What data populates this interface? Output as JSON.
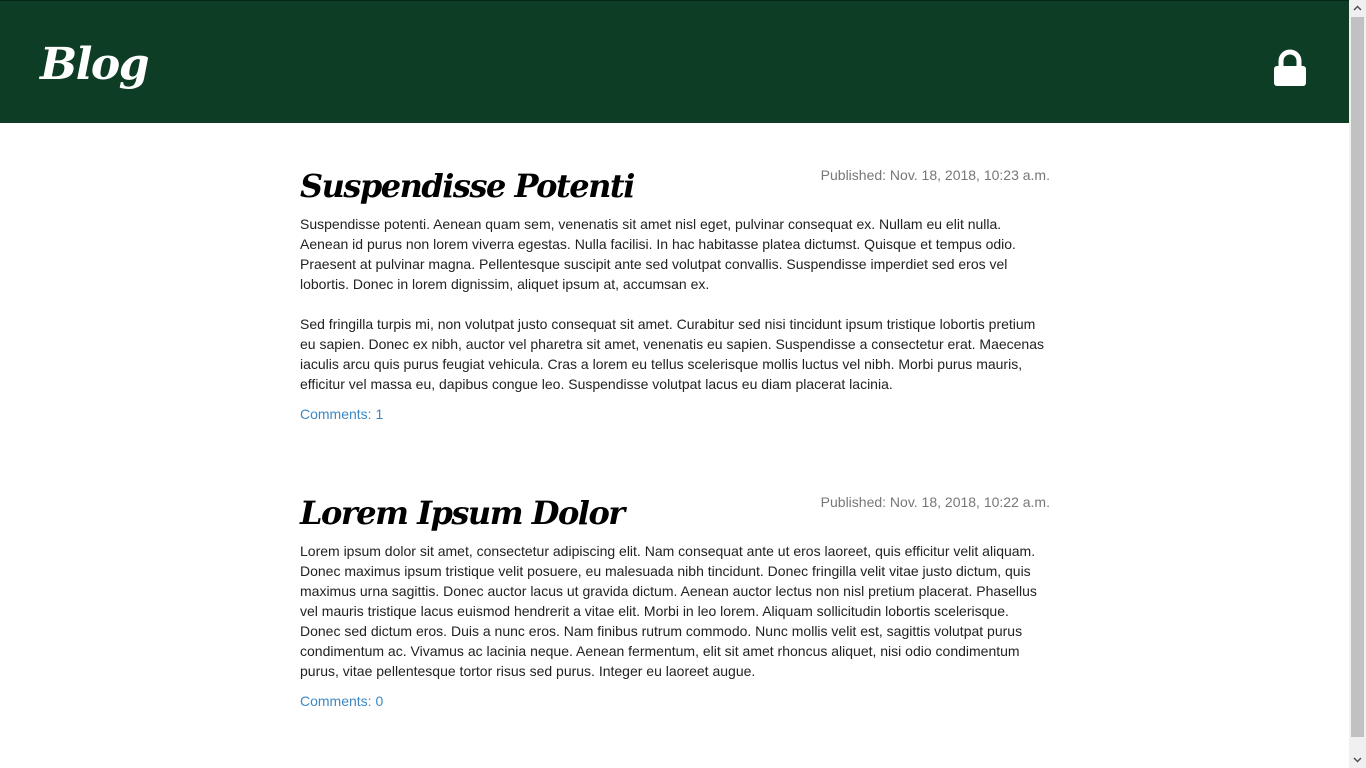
{
  "header": {
    "brand": "Blog",
    "lock_icon": "lock-icon",
    "background_color": "#0e3d26"
  },
  "posts": [
    {
      "title": "Suspendisse Potenti",
      "published": "Published: Nov. 18, 2018, 10:23 a.m.",
      "paragraphs": [
        "Suspendisse potenti. Aenean quam sem, venenatis sit amet nisl eget, pulvinar consequat ex. Nullam eu elit nulla. Aenean id purus non lorem viverra egestas. Nulla facilisi. In hac habitasse platea dictumst. Quisque et tempus odio. Praesent at pulvinar magna. Pellentesque suscipit ante sed volutpat convallis. Suspendisse imperdiet sed eros vel lobortis. Donec in lorem dignissim, aliquet ipsum at, accumsan ex.",
        "Sed fringilla turpis mi, non volutpat justo consequat sit amet. Curabitur sed nisi tincidunt ipsum tristique lobortis pretium eu sapien. Donec ex nibh, auctor vel pharetra sit amet, venenatis eu sapien. Suspendisse a consectetur erat. Maecenas iaculis arcu quis purus feugiat vehicula. Cras a lorem eu tellus scelerisque mollis luctus vel nibh. Morbi purus mauris, efficitur vel massa eu, dapibus congue leo. Suspendisse volutpat lacus eu diam placerat lacinia."
      ],
      "comments": "Comments: 1"
    },
    {
      "title": "Lorem Ipsum Dolor",
      "published": "Published: Nov. 18, 2018, 10:22 a.m.",
      "paragraphs": [
        "Lorem ipsum dolor sit amet, consectetur adipiscing elit. Nam consequat ante ut eros laoreet, quis efficitur velit aliquam. Donec maximus ipsum tristique velit posuere, eu malesuada nibh tincidunt. Donec fringilla velit vitae justo dictum, quis maximus urna sagittis. Donec auctor lacus ut gravida dictum. Aenean auctor lectus non nisl pretium placerat. Phasellus vel mauris tristique lacus euismod hendrerit a vitae elit. Morbi in leo lorem. Aliquam sollicitudin lobortis scelerisque. Donec sed dictum eros. Duis a nunc eros. Nam finibus rutrum commodo. Nunc mollis velit est, sagittis volutpat purus condimentum ac. Vivamus ac lacinia neque. Aenean fermentum, elit sit amet rhoncus aliquet, nisi odio condimentum purus, vitae pellentesque tortor risus sed purus. Integer eu laoreet augue."
      ],
      "comments": "Comments: 0"
    }
  ],
  "colors": {
    "link": "#3d88c4",
    "date": "#777777"
  }
}
